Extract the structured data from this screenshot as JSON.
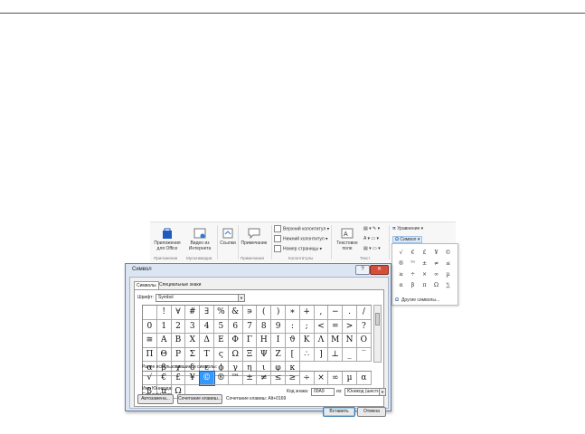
{
  "ribbon": {
    "apps_label": "Приложения для Office",
    "video_label": "Видео из Интернета",
    "links_label": "Ссылки",
    "note_label": "Примечание",
    "header": "Верхний колонтитул",
    "footer": "Нижний колонтитул",
    "page_number": "Номер страницы",
    "textbox_label": "Текстовое поле",
    "equation": "Уравнение",
    "symbol": "Символ",
    "group_apps": "Приложения",
    "group_media": "Мультимедиа",
    "group_notes": "Примечания",
    "group_hf": "Колонтитулы",
    "group_text": "Текст"
  },
  "symbol_dropdown": {
    "symbols": [
      "√",
      "€",
      "£",
      "¥",
      "©",
      "®",
      "™",
      "±",
      "≠",
      "≤",
      "≥",
      "÷",
      "×",
      "∞",
      "µ",
      "α",
      "β",
      "π",
      "Ω",
      "∑"
    ],
    "more": "Другие символы..."
  },
  "dialog": {
    "title": "Символ",
    "help": "?",
    "close": "✕",
    "tab_symbols": "Символы",
    "tab_special": "Специальные знаки",
    "font_label": "Шрифт:",
    "font_value": "Symbol",
    "grid": [
      " ",
      "!",
      "∀",
      "#",
      "∃",
      "%",
      "&",
      "∍",
      "(",
      ")",
      "∗",
      "+",
      ",",
      "−",
      ".",
      "/",
      "0",
      "1",
      "2",
      "3",
      "4",
      "5",
      "6",
      "7",
      "8",
      "9",
      ":",
      ";",
      "<",
      "=",
      ">",
      "?",
      "≅",
      "Α",
      "Β",
      "Χ",
      "Δ",
      "Ε",
      "Φ",
      "Γ",
      "Η",
      "Ι",
      "ϑ",
      "Κ",
      "Λ",
      "Μ",
      "Ν",
      "Ο",
      "Π",
      "Θ",
      "Ρ",
      "Σ",
      "Τ",
      "ς",
      "Ω",
      "Ξ",
      "Ψ",
      "Ζ",
      "[",
      "∴",
      "]",
      "⊥",
      "_",
      "‾",
      "α",
      "β",
      "χ",
      "δ",
      "ε",
      "ϕ",
      "γ",
      "η",
      "ι",
      "φ",
      "κ"
    ],
    "recent_label": "Ранее использовавшиеся символы:",
    "recent": [
      "√",
      "€",
      "£",
      "¥",
      "©",
      "®",
      "™",
      "±",
      "≠",
      "≤",
      "≥",
      "÷",
      "×",
      "∞",
      "µ",
      "α",
      "β",
      "π",
      "Ω"
    ],
    "unicode_name_label": "Имя Юникода:",
    "unicode_name": "Copyright Sign",
    "code_label": "Код знака:",
    "code_value": "00A9",
    "from_label": "из:",
    "from_value": "Юникод (шестн.)",
    "autocorrect": "Автозамена...",
    "shortcut_btn": "Сочетание клавиш...",
    "shortcut_text": "Сочетание клавиш: Alt+0169",
    "insert": "Вставить",
    "cancel": "Отмена"
  }
}
